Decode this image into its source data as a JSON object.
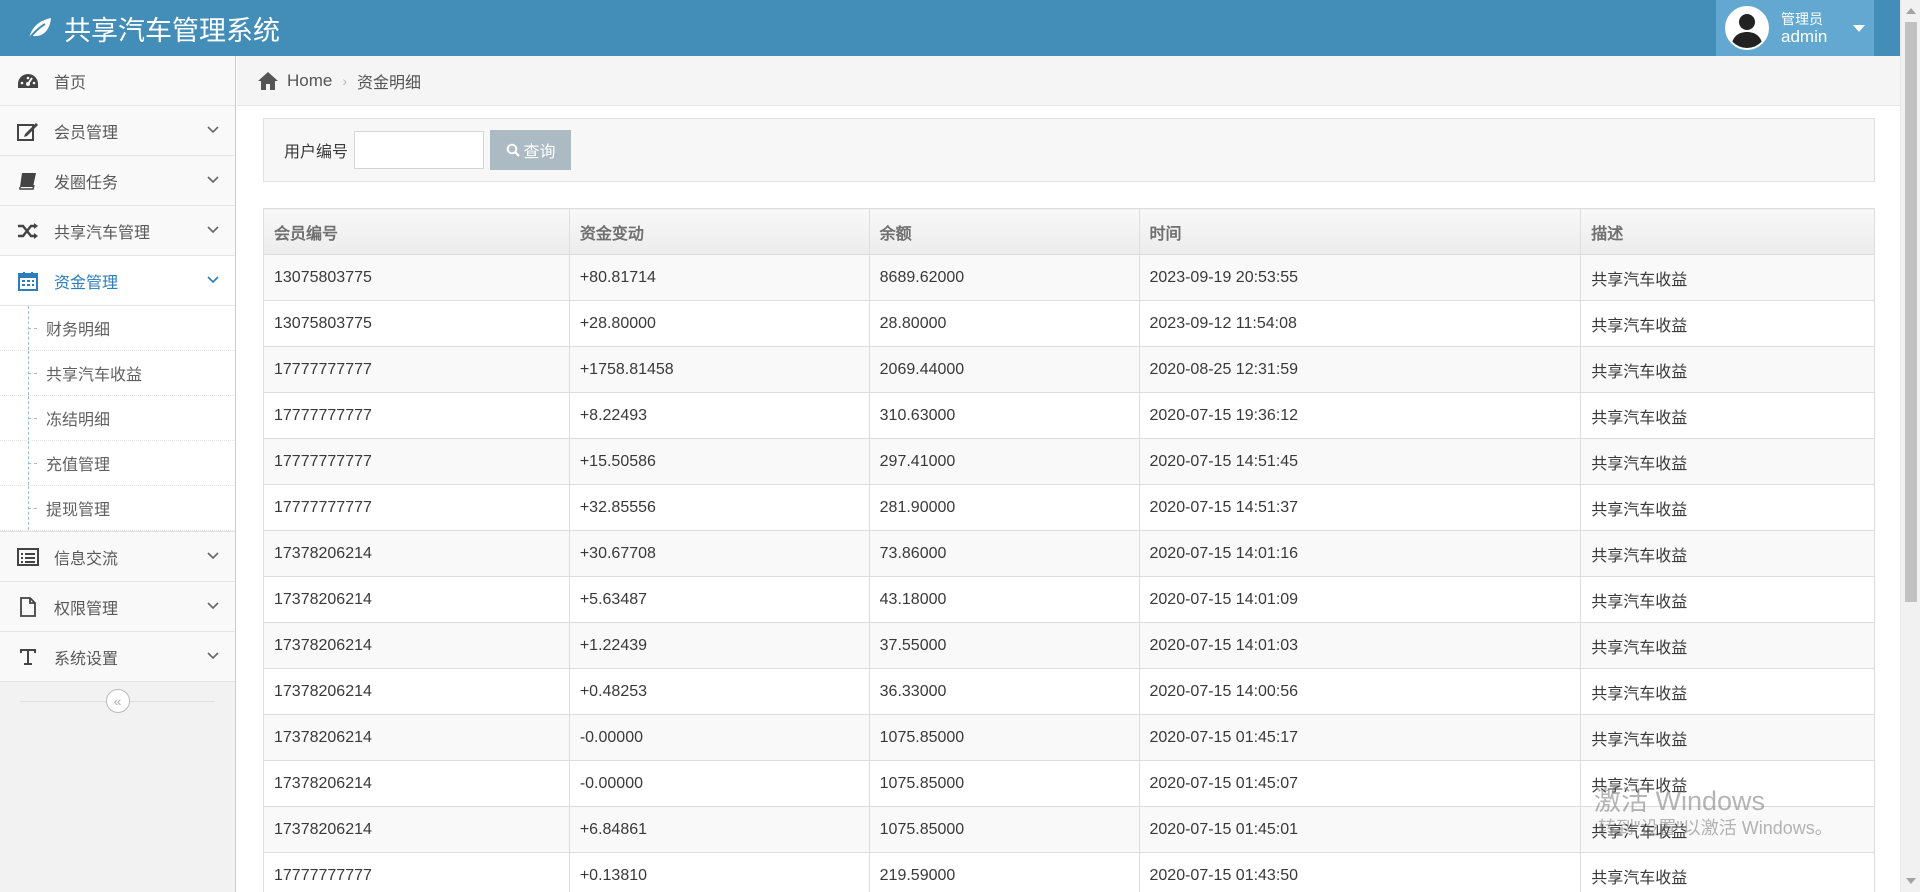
{
  "header": {
    "brand": "共享汽车管理系统",
    "user_role": "管理员",
    "user_name": "admin"
  },
  "sidebar": {
    "items": [
      {
        "label": "首页",
        "icon": "dashboard-icon",
        "expandable": false
      },
      {
        "label": "会员管理",
        "icon": "edit-icon",
        "expandable": true
      },
      {
        "label": "发圈任务",
        "icon": "book-icon",
        "expandable": true
      },
      {
        "label": "共享汽车管理",
        "icon": "shuffle-icon",
        "expandable": true
      },
      {
        "label": "资金管理",
        "icon": "calendar-icon",
        "expandable": true,
        "active": true
      },
      {
        "label": "信息交流",
        "icon": "list-icon",
        "expandable": true
      },
      {
        "label": "权限管理",
        "icon": "file-icon",
        "expandable": true
      },
      {
        "label": "系统设置",
        "icon": "text-icon",
        "expandable": true
      }
    ],
    "submenu": [
      "财务明细",
      "共享汽车收益",
      "冻结明细",
      "充值管理",
      "提现管理"
    ]
  },
  "breadcrumb": {
    "home": "Home",
    "current": "资金明细"
  },
  "search": {
    "label": "用户编号",
    "value": "",
    "button": "查询"
  },
  "table": {
    "headers": [
      "会员编号",
      "资金变动",
      "余额",
      "时间",
      "描述"
    ],
    "rows": [
      [
        "13075803775",
        "+80.81714",
        "8689.62000",
        "2023-09-19 20:53:55",
        "共享汽车收益"
      ],
      [
        "13075803775",
        "+28.80000",
        "28.80000",
        "2023-09-12 11:54:08",
        "共享汽车收益"
      ],
      [
        "17777777777",
        "+1758.81458",
        "2069.44000",
        "2020-08-25 12:31:59",
        "共享汽车收益"
      ],
      [
        "17777777777",
        "+8.22493",
        "310.63000",
        "2020-07-15 19:36:12",
        "共享汽车收益"
      ],
      [
        "17777777777",
        "+15.50586",
        "297.41000",
        "2020-07-15 14:51:45",
        "共享汽车收益"
      ],
      [
        "17777777777",
        "+32.85556",
        "281.90000",
        "2020-07-15 14:51:37",
        "共享汽车收益"
      ],
      [
        "17378206214",
        "+30.67708",
        "73.86000",
        "2020-07-15 14:01:16",
        "共享汽车收益"
      ],
      [
        "17378206214",
        "+5.63487",
        "43.18000",
        "2020-07-15 14:01:09",
        "共享汽车收益"
      ],
      [
        "17378206214",
        "+1.22439",
        "37.55000",
        "2020-07-15 14:01:03",
        "共享汽车收益"
      ],
      [
        "17378206214",
        "+0.48253",
        "36.33000",
        "2020-07-15 14:00:56",
        "共享汽车收益"
      ],
      [
        "17378206214",
        "-0.00000",
        "1075.85000",
        "2020-07-15 01:45:17",
        "共享汽车收益"
      ],
      [
        "17378206214",
        "-0.00000",
        "1075.85000",
        "2020-07-15 01:45:07",
        "共享汽车收益"
      ],
      [
        "17378206214",
        "+6.84861",
        "1075.85000",
        "2020-07-15 01:45:01",
        "共享汽车收益"
      ],
      [
        "17777777777",
        "+0.13810",
        "219.59000",
        "2020-07-15 01:43:50",
        "共享汽车收益"
      ]
    ]
  },
  "watermark": {
    "title": "激活 Windows",
    "subtitle": "转到\"设置\"以激活 Windows。"
  },
  "colors": {
    "navbar": "#438eb9",
    "user_box": "#62a8d1",
    "active_link": "#2b7dbc",
    "search_button": "#abbac3"
  }
}
